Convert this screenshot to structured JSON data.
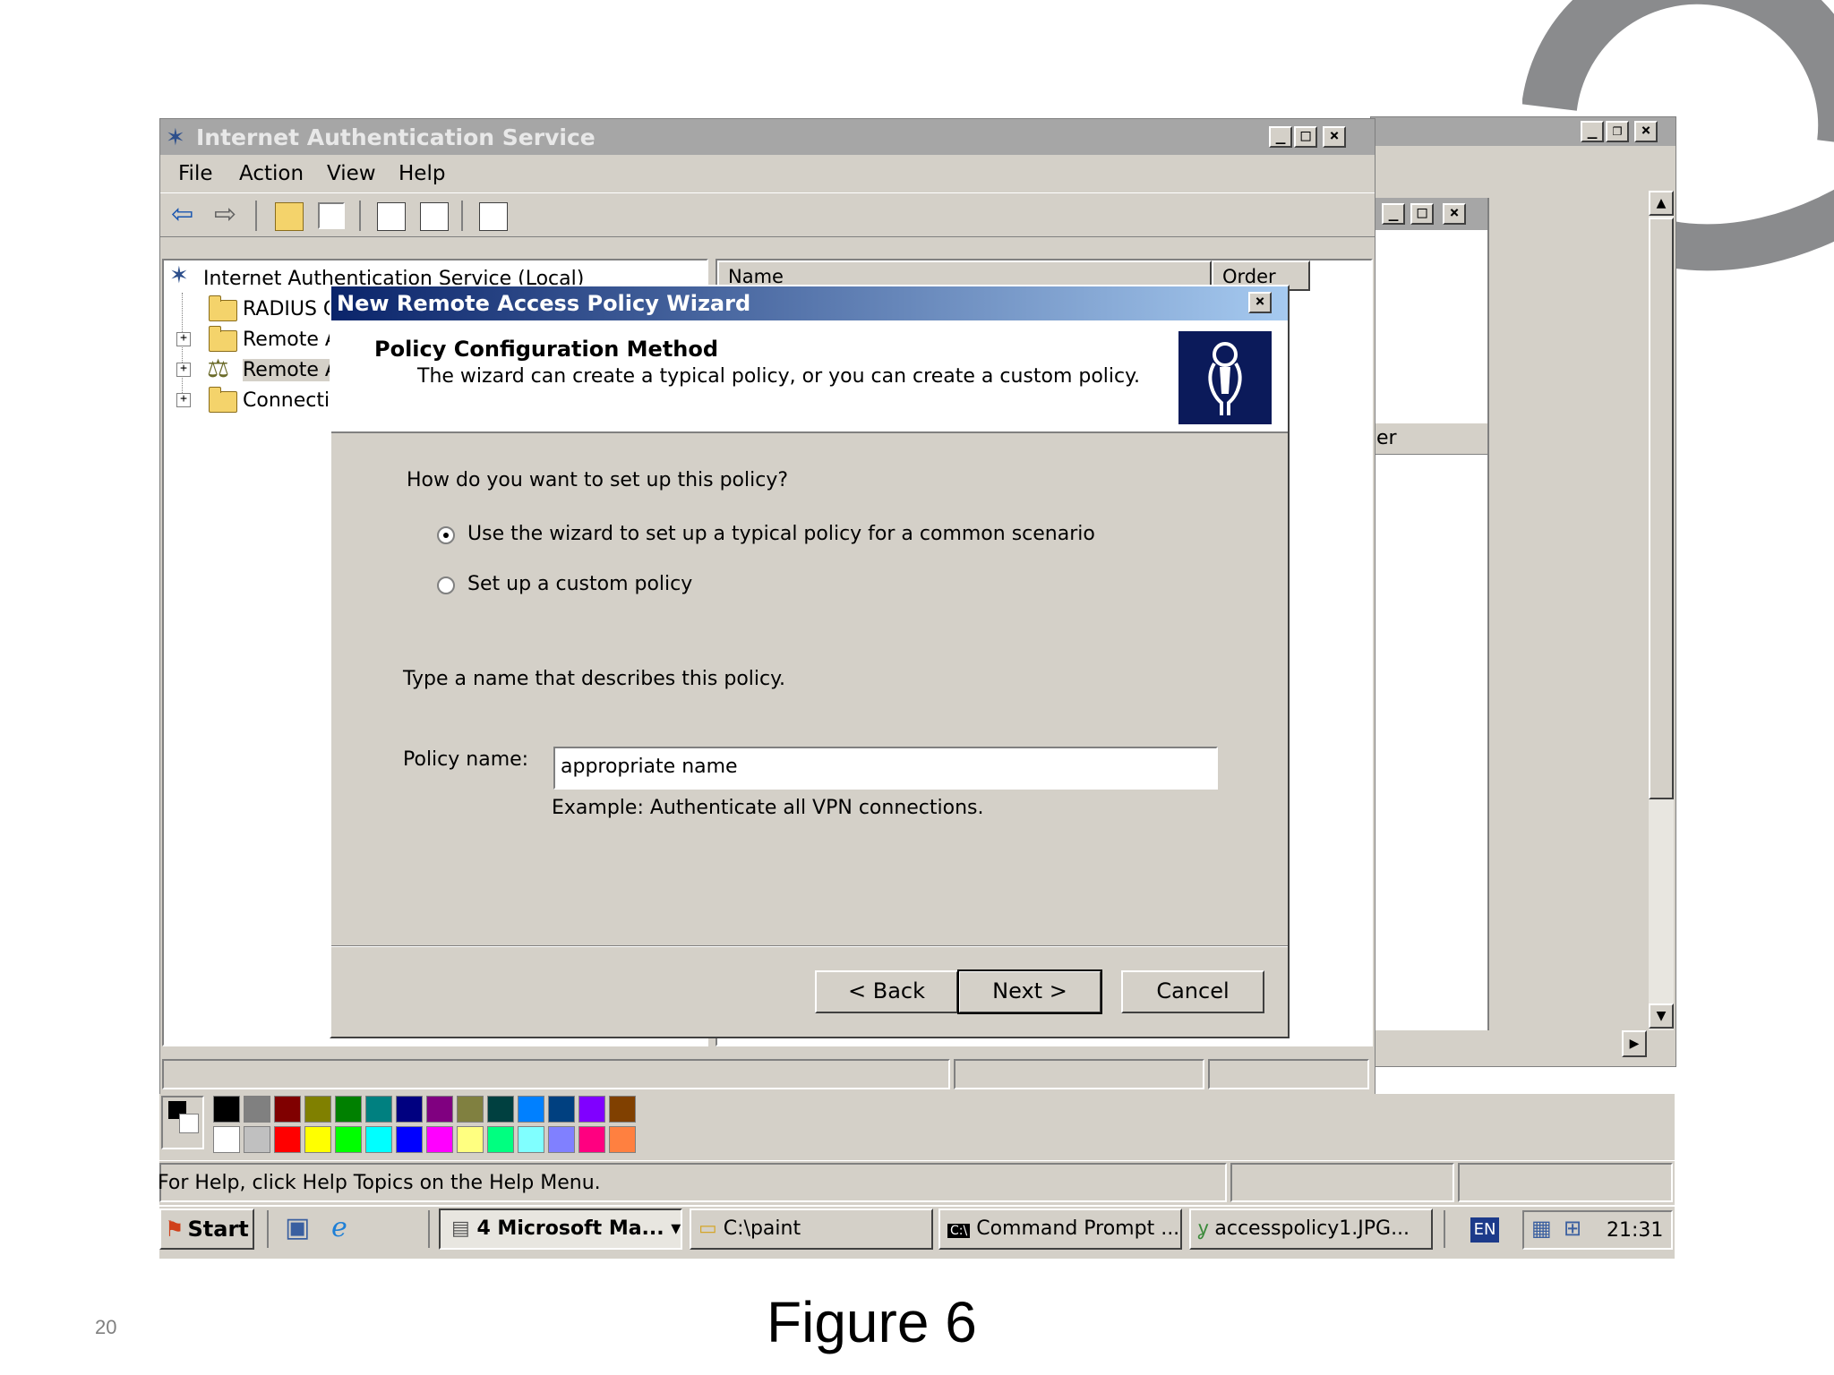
{
  "main_window": {
    "title": "Internet Authentication Service",
    "menu": [
      "File",
      "Action",
      "View",
      "Help"
    ],
    "tree": {
      "root": "Internet Authentication Service (Local)",
      "items": [
        "RADIUS C",
        "Remote A",
        "Remote A",
        "Connecti"
      ]
    },
    "list_headers": [
      "Name",
      "Order"
    ],
    "right_header_fragment": "er"
  },
  "dialog": {
    "title": "New Remote Access Policy Wizard",
    "header_title": "Policy Configuration Method",
    "header_subtitle": "The wizard can create a typical policy, or you can create a custom policy.",
    "question": "How do you want to set up this policy?",
    "options": [
      {
        "label": "Use the wizard to set up a typical policy for a common scenario",
        "selected": true
      },
      {
        "label": "Set up a custom policy",
        "selected": false
      }
    ],
    "name_prompt": "Type a name that describes this policy.",
    "policy_name_label": "Policy name:",
    "policy_name_value": "appropriate name",
    "example": "Example: Authenticate all VPN connections.",
    "buttons": {
      "back": "< Back",
      "next": "Next >",
      "cancel": "Cancel"
    }
  },
  "paint": {
    "status": "For Help, click Help Topics on the Help Menu.",
    "palette": [
      "#000000",
      "#808080",
      "#800000",
      "#808000",
      "#008000",
      "#008080",
      "#000080",
      "#800080",
      "#808040",
      "#004040",
      "#0080ff",
      "#004080",
      "#8000ff",
      "#804000",
      "#ffffff",
      "#c0c0c0",
      "#ff0000",
      "#ffff00",
      "#00ff00",
      "#00ffff",
      "#0000ff",
      "#ff00ff",
      "#ffff80",
      "#00ff80",
      "#80ffff",
      "#8080ff",
      "#ff0080",
      "#ff8040"
    ]
  },
  "taskbar": {
    "start": "Start",
    "tasks": [
      "4 Microsoft Ma...",
      "C:\\paint",
      "Command Prompt ...",
      "accesspolicy1.JPG..."
    ],
    "language": "EN",
    "clock": "21:31"
  },
  "slide": {
    "caption": "Figure 6",
    "page_number": "20"
  },
  "colors": {
    "title_inactive": "#a6a6a6",
    "title_active_start": "#0a246a",
    "title_active_end": "#a6caf0",
    "face": "#d4d0c8",
    "logo": "#8a8b8d"
  }
}
